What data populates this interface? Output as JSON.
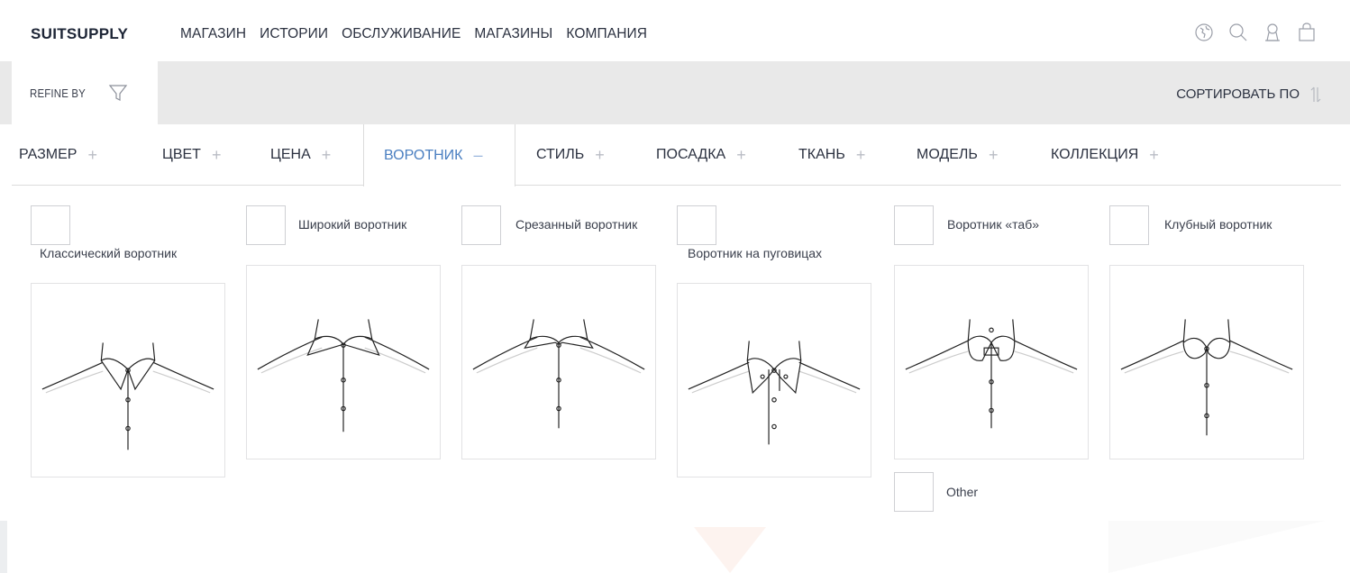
{
  "brand": "SUITSUPPLY",
  "nav": {
    "links": [
      "МАГАЗИН",
      "ИСТОРИИ",
      "ОБСЛУЖИВАНИЕ",
      "МАГАЗИНЫ",
      "КОМПАНИЯ"
    ],
    "icons": [
      "globe-icon",
      "search-icon",
      "account-icon",
      "bag-icon"
    ]
  },
  "refine": {
    "label": "REFINE BY",
    "sort_label": "СОРТИРОВАТЬ ПО"
  },
  "filter_tabs": [
    {
      "label": "РАЗМЕР",
      "sign": "+"
    },
    {
      "label": "ЦВЕТ",
      "sign": "+"
    },
    {
      "label": "ЦЕНА",
      "sign": "+"
    },
    {
      "label": "ВОРОТНИК",
      "sign": "–",
      "active": true
    },
    {
      "label": "СТИЛЬ",
      "sign": "+"
    },
    {
      "label": "ПОСАДКА",
      "sign": "+"
    },
    {
      "label": "ТКАНЬ",
      "sign": "+"
    },
    {
      "label": "МОДЕЛЬ",
      "sign": "+"
    },
    {
      "label": "КОЛЛЕКЦИЯ",
      "sign": "+"
    }
  ],
  "collars": [
    {
      "label": "Классический воротник",
      "variant": "classic"
    },
    {
      "label": "Широкий воротник",
      "variant": "wide"
    },
    {
      "label": "Срезанный воротник",
      "variant": "cutaway"
    },
    {
      "label": "Воротник на пуговицах",
      "variant": "buttondown"
    },
    {
      "label": "Воротник «таб»",
      "variant": "tab"
    },
    {
      "label": "Клубный воротник",
      "variant": "club"
    },
    {
      "label": "Other",
      "variant": "none"
    }
  ],
  "colors": {
    "accent": "#4a7fc1",
    "text": "#2b3140",
    "refine_bar_bg": "#e9e9e9"
  }
}
